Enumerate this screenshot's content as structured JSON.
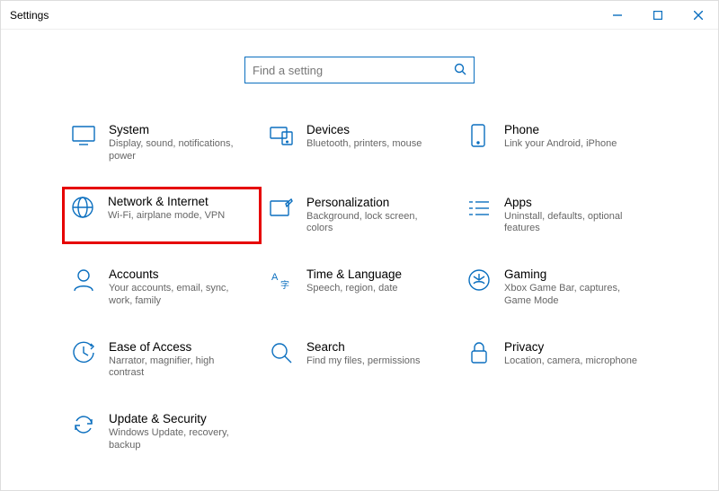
{
  "window": {
    "title": "Settings"
  },
  "search": {
    "placeholder": "Find a setting"
  },
  "tiles": {
    "system": {
      "title": "System",
      "desc": "Display, sound, notifications, power"
    },
    "devices": {
      "title": "Devices",
      "desc": "Bluetooth, printers, mouse"
    },
    "phone": {
      "title": "Phone",
      "desc": "Link your Android, iPhone"
    },
    "network": {
      "title": "Network & Internet",
      "desc": "Wi-Fi, airplane mode, VPN"
    },
    "personalization": {
      "title": "Personalization",
      "desc": "Background, lock screen, colors"
    },
    "apps": {
      "title": "Apps",
      "desc": "Uninstall, defaults, optional features"
    },
    "accounts": {
      "title": "Accounts",
      "desc": "Your accounts, email, sync, work, family"
    },
    "time": {
      "title": "Time & Language",
      "desc": "Speech, region, date"
    },
    "gaming": {
      "title": "Gaming",
      "desc": "Xbox Game Bar, captures, Game Mode"
    },
    "ease": {
      "title": "Ease of Access",
      "desc": "Narrator, magnifier, high contrast"
    },
    "search_tile": {
      "title": "Search",
      "desc": "Find my files, permissions"
    },
    "privacy": {
      "title": "Privacy",
      "desc": "Location, camera, microphone"
    },
    "update": {
      "title": "Update & Security",
      "desc": "Windows Update, recovery, backup"
    }
  }
}
